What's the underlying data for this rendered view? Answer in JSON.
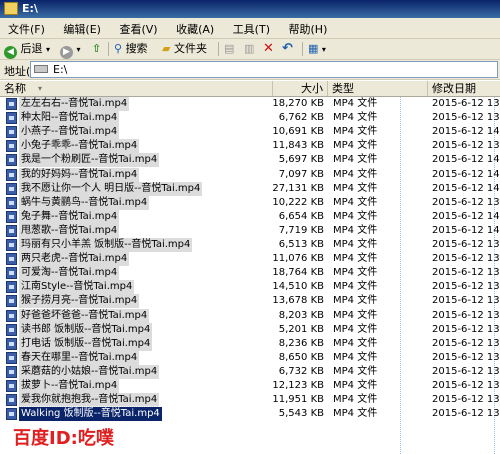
{
  "window": {
    "title": "E:\\"
  },
  "menu": [
    "文件(F)",
    "编辑(E)",
    "查看(V)",
    "收藏(A)",
    "工具(T)",
    "帮助(H)"
  ],
  "toolbar": {
    "back": "后退",
    "search": "搜索",
    "folders": "文件夹"
  },
  "address": {
    "label": "地址(D)",
    "path": "E:\\"
  },
  "columns": {
    "name": "名称",
    "size": "大小",
    "type": "类型",
    "modified": "修改日期"
  },
  "files": [
    {
      "name": "左左右右--音悦Tai.mp4",
      "size": "18,270 KB",
      "type": "MP4 文件",
      "date": "2015-6-12 13:5"
    },
    {
      "name": "种太阳--音悦Tai.mp4",
      "size": "6,762 KB",
      "type": "MP4 文件",
      "date": "2015-6-12 13:5"
    },
    {
      "name": "小燕子--音悦Tai.mp4",
      "size": "10,691 KB",
      "type": "MP4 文件",
      "date": "2015-6-12 14:0"
    },
    {
      "name": "小兔子乖乖--音悦Tai.mp4",
      "size": "11,843 KB",
      "type": "MP4 文件",
      "date": "2015-6-12 13:5"
    },
    {
      "name": "我是一个粉刷匠--音悦Tai.mp4",
      "size": "5,697 KB",
      "type": "MP4 文件",
      "date": "2015-6-12 14:"
    },
    {
      "name": "我的好妈妈--音悦Tai.mp4",
      "size": "7,097 KB",
      "type": "MP4 文件",
      "date": "2015-6-12 14:"
    },
    {
      "name": "我不愿让你一个人 明日版--音悦Tai.mp4",
      "size": "27,131 KB",
      "type": "MP4 文件",
      "date": "2015-6-12 14:"
    },
    {
      "name": "蜗牛与黄鹂鸟--音悦Tai.mp4",
      "size": "10,222 KB",
      "type": "MP4 文件",
      "date": "2015-6-12 13:5"
    },
    {
      "name": "兔子舞--音悦Tai.mp4",
      "size": "6,654 KB",
      "type": "MP4 文件",
      "date": "2015-6-12 14:"
    },
    {
      "name": "甩葱歌--音悦Tai.mp4",
      "size": "7,719 KB",
      "type": "MP4 文件",
      "date": "2015-6-12 14:"
    },
    {
      "name": "玛丽有只小羊羔 饭制版--音悦Tai.mp4",
      "size": "6,513 KB",
      "type": "MP4 文件",
      "date": "2015-6-12 13:5"
    },
    {
      "name": "两只老虎--音悦Tai.mp4",
      "size": "11,076 KB",
      "type": "MP4 文件",
      "date": "2015-6-12 13:5"
    },
    {
      "name": "可爱淘--音悦Tai.mp4",
      "size": "18,764 KB",
      "type": "MP4 文件",
      "date": "2015-6-12 13:5"
    },
    {
      "name": "江南Style--音悦Tai.mp4",
      "size": "14,510 KB",
      "type": "MP4 文件",
      "date": "2015-6-12 13:5"
    },
    {
      "name": "猴子捞月亮--音悦Tai.mp4",
      "size": "13,678 KB",
      "type": "MP4 文件",
      "date": "2015-6-12 13:5"
    },
    {
      "name": "好爸爸坏爸爸--音悦Tai.mp4",
      "size": "8,203 KB",
      "type": "MP4 文件",
      "date": "2015-6-12 13:5"
    },
    {
      "name": "读书郎 饭制版--音悦Tai.mp4",
      "size": "5,201 KB",
      "type": "MP4 文件",
      "date": "2015-6-12 13:5"
    },
    {
      "name": "打电话 饭制版--音悦Tai.mp4",
      "size": "8,236 KB",
      "type": "MP4 文件",
      "date": "2015-6-12 13:5"
    },
    {
      "name": "春天在哪里--音悦Tai.mp4",
      "size": "8,650 KB",
      "type": "MP4 文件",
      "date": "2015-6-12 13:5"
    },
    {
      "name": "采蘑菇的小姑娘--音悦Tai.mp4",
      "size": "6,732 KB",
      "type": "MP4 文件",
      "date": "2015-6-12 13:5"
    },
    {
      "name": "拔萝卜--音悦Tai.mp4",
      "size": "12,123 KB",
      "type": "MP4 文件",
      "date": "2015-6-12 13:5"
    },
    {
      "name": "爱我你就抱抱我--音悦Tai.mp4",
      "size": "11,951 KB",
      "type": "MP4 文件",
      "date": "2015-6-12 13:5"
    },
    {
      "name": "Walking 饭制版--音悦Tai.mp4",
      "size": "5,543 KB",
      "type": "MP4 文件",
      "date": "2015-6-12 13:5",
      "selected": true
    }
  ],
  "watermark": "百度ID:吃噗"
}
